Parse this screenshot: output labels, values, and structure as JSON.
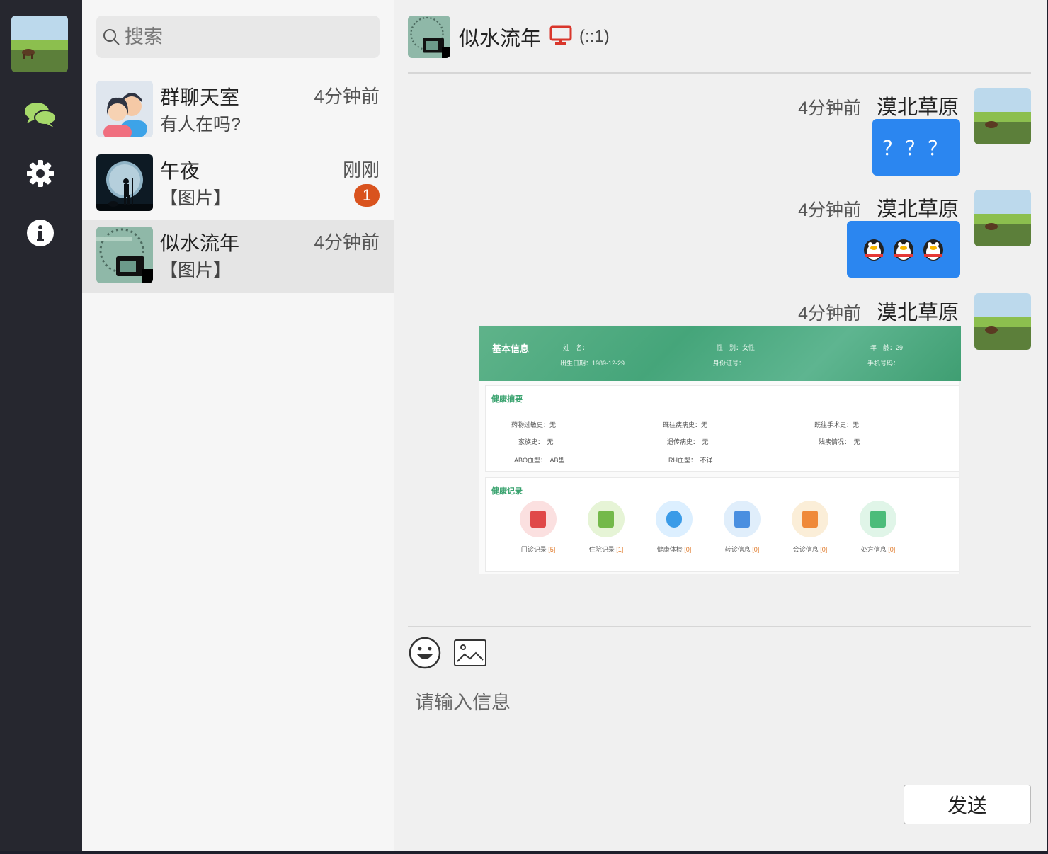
{
  "me": {
    "avatar": "grassland-cow-avatar"
  },
  "nav": [
    {
      "name": "chat-icon",
      "color": "#a6d96a"
    },
    {
      "name": "gear-icon",
      "color": "#ffffff"
    },
    {
      "name": "info-icon",
      "color": "#ffffff"
    }
  ],
  "search": {
    "placeholder": "搜索"
  },
  "conversations": [
    {
      "name": "群聊天室",
      "time": "4分钟前",
      "preview": "有人在吗?",
      "avatar": "group-avatar"
    },
    {
      "name": "午夜",
      "time": "刚刚",
      "preview": "【图片】",
      "badge": "1",
      "avatar": "midnight-avatar"
    },
    {
      "name": "似水流年",
      "time": "4分钟前",
      "preview": "【图片】",
      "avatar": "camera-avatar",
      "active": true
    }
  ],
  "chat": {
    "title": "似水流年",
    "address": "(::1)",
    "messages": [
      {
        "time": "4分钟前",
        "sender": "漠北草原",
        "text": "？？？"
      },
      {
        "time": "4分钟前",
        "sender": "漠北草原",
        "type": "emoji",
        "emoji": "qq-penguin-emoji x3"
      },
      {
        "time": "4分钟前",
        "sender": "漠北草原",
        "type": "image"
      }
    ],
    "record": {
      "header_title": "基本信息",
      "name_label": "姓　名：",
      "gender_label": "性　别：",
      "gender": "女性",
      "age_label": "年　龄：",
      "age": "29",
      "birth_label": "出生日期：",
      "birth": "1989-12-29",
      "id_label": "身份证号：",
      "phone_label": "手机号码：",
      "summary_title": "健康摘要",
      "allergy": "药物过敏史：无",
      "disease": "既往疾病史：无",
      "surgery": "既往手术史：无",
      "family": "家族史：　无",
      "genetic": "遗传病史：　无",
      "disability": "残疾情况：　无",
      "abo": "ABO血型：　AB型",
      "rh": "RH血型：　不详",
      "records_title": "健康记录",
      "items": [
        {
          "label": "门诊记录",
          "count": "[5]"
        },
        {
          "label": "住院记录",
          "count": "[1]"
        },
        {
          "label": "健康体检",
          "count": "[0]"
        },
        {
          "label": "转诊信息",
          "count": "[0]"
        },
        {
          "label": "会诊信息",
          "count": "[0]"
        },
        {
          "label": "处方信息",
          "count": "[0]"
        }
      ]
    },
    "input_placeholder": "请输入信息",
    "send_label": "发送"
  },
  "colors": {
    "accent": "#2b86f0",
    "badge": "#d9531e",
    "rail": "#26272f",
    "record_green": "#4aa97c"
  }
}
